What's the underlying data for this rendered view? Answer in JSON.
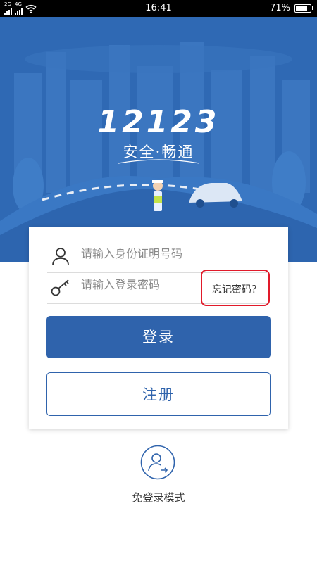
{
  "status_bar": {
    "network_1": "2G",
    "network_2": "4G",
    "time": "16:41",
    "battery": "71%",
    "battery_level": 0.71
  },
  "hero": {
    "logo_text": "12123",
    "slogan": "安全·畅通",
    "background_color": "#2f69b4"
  },
  "login_form": {
    "id_placeholder": "请输入身份证明号码",
    "password_placeholder": "请输入登录密码",
    "forgot_password": "忘记密码？",
    "login_button": "登录",
    "register_button": "注册",
    "accent_color": "#2f63ac",
    "highlight_color": "#e11a2a"
  },
  "guest_mode": {
    "label": "免登录模式"
  },
  "icons": [
    "person-icon",
    "key-icon",
    "guest-mode-icon",
    "wifi-icon",
    "battery-icon"
  ]
}
